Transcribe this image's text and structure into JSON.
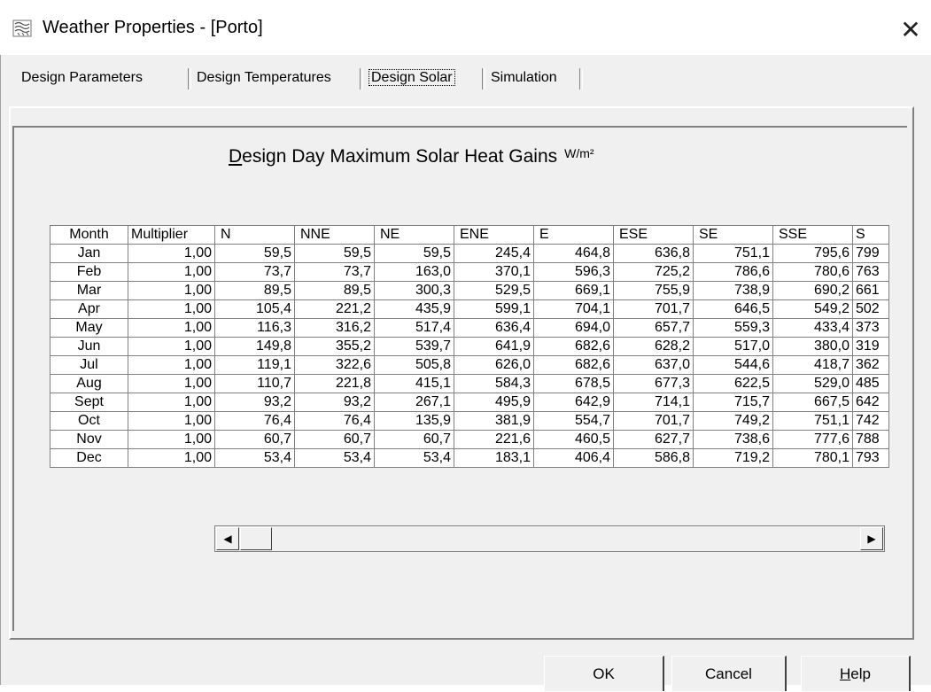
{
  "window": {
    "title": "Weather Properties - [Porto]",
    "close_glyph": "✕",
    "icon": "weather-app-icon"
  },
  "tabs": [
    {
      "label": "Design Parameters",
      "active": false
    },
    {
      "label": "Design Temperatures",
      "active": false
    },
    {
      "label": "Design Solar",
      "active": true
    },
    {
      "label": "Simulation",
      "active": false
    }
  ],
  "heading": {
    "first_letter": "D",
    "rest": "esign Day Maximum Solar Heat Gains",
    "unit": "W/m²"
  },
  "table": {
    "columns": [
      "Month",
      "Multiplier",
      "N",
      "NNE",
      "NE",
      "ENE",
      "E",
      "ESE",
      "SE",
      "SSE",
      "S"
    ],
    "rows": [
      [
        "Jan",
        "1,00",
        "59,5",
        "59,5",
        "59,5",
        "245,4",
        "464,8",
        "636,8",
        "751,1",
        "795,6",
        "799"
      ],
      [
        "Feb",
        "1,00",
        "73,7",
        "73,7",
        "163,0",
        "370,1",
        "596,3",
        "725,2",
        "786,6",
        "780,6",
        "763"
      ],
      [
        "Mar",
        "1,00",
        "89,5",
        "89,5",
        "300,3",
        "529,5",
        "669,1",
        "755,9",
        "738,9",
        "690,2",
        "661"
      ],
      [
        "Apr",
        "1,00",
        "105,4",
        "221,2",
        "435,9",
        "599,1",
        "704,1",
        "701,7",
        "646,5",
        "549,2",
        "502"
      ],
      [
        "May",
        "1,00",
        "116,3",
        "316,2",
        "517,4",
        "636,4",
        "694,0",
        "657,7",
        "559,3",
        "433,4",
        "373"
      ],
      [
        "Jun",
        "1,00",
        "149,8",
        "355,2",
        "539,7",
        "641,9",
        "682,6",
        "628,2",
        "517,0",
        "380,0",
        "319"
      ],
      [
        "Jul",
        "1,00",
        "119,1",
        "322,6",
        "505,8",
        "626,0",
        "682,6",
        "637,0",
        "544,6",
        "418,7",
        "362"
      ],
      [
        "Aug",
        "1,00",
        "110,7",
        "221,8",
        "415,1",
        "584,3",
        "678,5",
        "677,3",
        "622,5",
        "529,0",
        "485"
      ],
      [
        "Sept",
        "1,00",
        "93,2",
        "93,2",
        "267,1",
        "495,9",
        "642,9",
        "714,1",
        "715,7",
        "667,5",
        "642"
      ],
      [
        "Oct",
        "1,00",
        "76,4",
        "76,4",
        "135,9",
        "381,9",
        "554,7",
        "701,7",
        "749,2",
        "751,1",
        "742"
      ],
      [
        "Nov",
        "1,00",
        "60,7",
        "60,7",
        "60,7",
        "221,6",
        "460,5",
        "627,7",
        "738,6",
        "777,6",
        "788"
      ],
      [
        "Dec",
        "1,00",
        "53,4",
        "53,4",
        "53,4",
        "183,1",
        "406,4",
        "586,8",
        "719,2",
        "780,1",
        "793"
      ]
    ]
  },
  "scrollbar": {
    "left_arrow": "◀",
    "right_arrow": "▶"
  },
  "buttons": {
    "ok": "OK",
    "cancel": "Cancel",
    "help_first": "H",
    "help_rest": "elp"
  }
}
